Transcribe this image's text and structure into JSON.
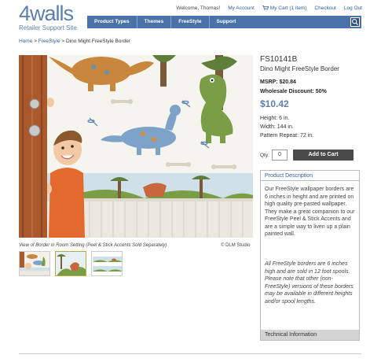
{
  "brand": {
    "name": "4walls",
    "subtitle": "Retailer Support Site"
  },
  "topnav": {
    "welcome": "Welcome, Thomas!",
    "account": "My Account",
    "cart": "My Cart (1 item)",
    "checkout": "Checkout",
    "logout": "Log Out"
  },
  "navbar": {
    "items": [
      "Product Types",
      "Themes",
      "FreeStyle",
      "Support"
    ]
  },
  "breadcrumb": {
    "home": "Home",
    "sep": " > ",
    "section": "FreeStyle",
    "current": "Dino Might FreeStyle Border"
  },
  "product": {
    "sku": "FS10141B",
    "name": "Dino Might FreeStyle Border",
    "msrp": "MSRP: $20.84",
    "wholesale": "Wholesale Discount: 50%",
    "price": "$10.42",
    "height": "Height: 6 in.",
    "width": "Width: 144 in.",
    "repeat": "Pattern Repeat: 72 in.",
    "qty_label": "Qty:",
    "qty_value": "0",
    "add_to_cart": "Add to Cart"
  },
  "image": {
    "caption": "View of Border in Room Setting (Peel & Stick Accents Sold Separately)",
    "credit": "© DLM Studio"
  },
  "description": {
    "tab": "Product Description",
    "body": "Our FreeStyle wallpaper borders are 6 inches in height and are printed on high quality pre-pasted wallpaper. They make a great companion to our FreeStyle Peel & Stick Accents and are a simple way to liven up a plain painted wall.",
    "note": "All FreeStyle borders are 6 inches high and are sold in 12 foot spools. Please note that other (non-FreeStyle) versions of these borders may be available in different heights and/or spool lengths.",
    "tech_tab": "Technical Information"
  },
  "colors": {
    "brand_blue": "#5a7fb0",
    "nav_blue": "#4a72a8",
    "link": "#2f5fa0"
  }
}
